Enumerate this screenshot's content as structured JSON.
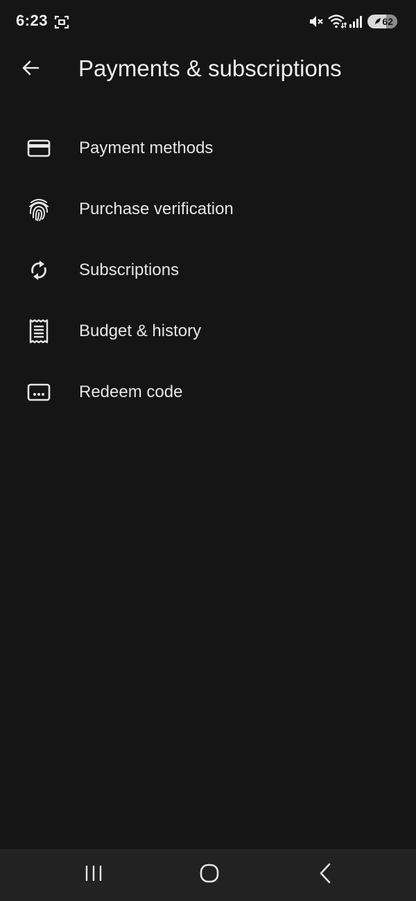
{
  "status_bar": {
    "time": "6:23",
    "battery_level": "62",
    "icons": [
      "screenshot-icon",
      "mute-icon",
      "wifi-icon",
      "signal-icon",
      "battery-icon"
    ]
  },
  "app_bar": {
    "title": "Payments & subscriptions",
    "back_icon": "arrow-back-icon"
  },
  "menu": {
    "items": [
      {
        "label": "Payment methods",
        "icon": "credit-card-icon"
      },
      {
        "label": "Purchase verification",
        "icon": "fingerprint-icon"
      },
      {
        "label": "Subscriptions",
        "icon": "sync-icon"
      },
      {
        "label": "Budget & history",
        "icon": "receipt-icon"
      },
      {
        "label": "Redeem code",
        "icon": "redeem-code-icon"
      }
    ]
  },
  "nav_bar": {
    "icons": [
      "recent-apps-icon",
      "home-icon",
      "back-icon"
    ]
  },
  "colors": {
    "background": "#151515",
    "text": "#e9e9e9",
    "nav_background": "#222222"
  }
}
